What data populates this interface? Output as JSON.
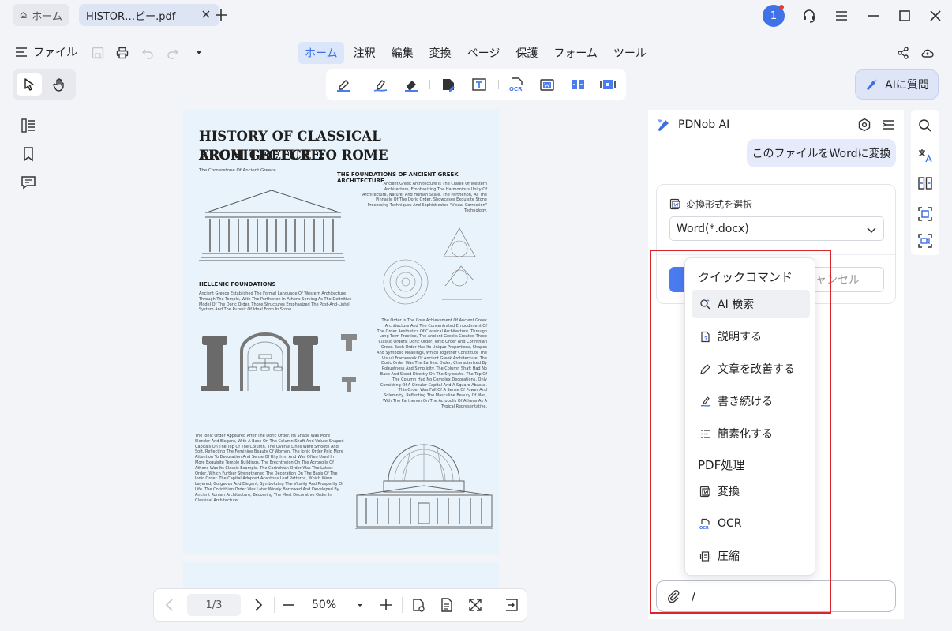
{
  "titlebar": {
    "home_tab": "ホーム",
    "file_tab": "HISTOR…ピー.pdf",
    "notification_count": "1"
  },
  "menubar": {
    "file_menu": "ファイル",
    "tabs": [
      "ホーム",
      "注釈",
      "編集",
      "変換",
      "ページ",
      "保護",
      "フォーム",
      "ツール"
    ],
    "active_tab": "ホーム"
  },
  "toolbar": {
    "ai_button": "AIに質問"
  },
  "document": {
    "title_line1": "HISTORY OF CLASSICAL  ARCHITECTURE:",
    "title_line2": "FROM GREECE TO ROME",
    "subtitle": "The Cornerstone Of Ancient Greece",
    "foundations_heading": "THE FOUNDATIONS OF ANCIENT GREEK ARCHITECTURE",
    "foundations_text": "Ancient Greek Architecture Is The Cradle Of Western Architecture, Emphasizing The Harmonious Unity Of Architecture, Nature, And Human Scale. The Parthenon, As The Pinnacle Of The Doric Order, Showcases Exquisite Stone Processing Techniques And Sophisticated \"Visual Correction\" Technology.",
    "hellenic_heading": "HELLENIC FOUNDATIONS",
    "hellenic_text": "Ancient Greece Established The Formal Language Of Western Architecture Through The Temple, With The Parthenon In Athens Serving As The Definitive Model Of The Doric Order. Those Structures Emphasized The Post-And-Lintel System And The Pursuit Of Ideal Form In Stone.",
    "order_text": "The Order Is The Core Achievement Of Ancient Greek Architecture And The Concentrated Embodiment Of The Order Aesthetics Of Classical Architecture. Through Long-Term Practice, The Ancient Greeks Created Three Classic Orders: Doric Order, Ionic Order And Corinthian Order. Each Order Has Its Unique Proportions, Shapes And Symbolic Meanings, Which Together Constitute The Visual Framework Of Ancient Greek Architecture. The Doric Order Was The Earliest Order, Characterized By Robustness And Simplicity. The Column Shaft Had No Base And Stood Directly On The Stylobate. The Top Of The Column Had No Complex Decorations, Only Consisting Of A Circular Capital And A Square Abacus. This Order Was Full Of A Sense Of Power And Solemnity, Reflecting The Masculine Beauty Of Man, With The Parthenon On The Acropolis Of Athens As A Typical Representative.",
    "ionic_text": "The Ionic Order Appeared After The Doric Order. Its Shape Was More Slender And Elegant, With A Base On The Column Shaft And Volute-Shaped Capitals On The Top Of The Column. The Overall Lines Were Smooth And Soft, Reflecting The Feminine Beauty Of Women. The Ionic Order Paid More Attention To Decoration And Sense Of Rhythm, And Was Often Used In More Exquisite Temple Buildings. The Erechtheion On The Acropolis Of Athens Was Its Classic Example. The Corinthian Order Was The Latest Order, Which Further Strengthened The Decoration On The Basis Of The Ionic Order. The Capital Adopted Acanthus Leaf Patterns, Which Were Layered, Gorgeous And Elegant, Symbolizing The Vitality And Prosperity Of Life. The Corinthian Order Was Later Widely Borrowed And Developed By Ancient Roman Architecture, Becoming The Most Decorative Order In Classical Architecture."
  },
  "bottom_nav": {
    "page_indicator": "1/3",
    "zoom": "50%"
  },
  "ai_panel": {
    "brand": "PDNob AI",
    "user_message": "このファイルをWordに変換",
    "convert_label": "変換形式を選択",
    "format_value": "Word(*.docx)",
    "cancel": "キャンセル",
    "input_value": "/"
  },
  "quick_popup": {
    "heading1": "クイックコマンド",
    "commands": [
      "AI 検索",
      "説明する",
      "文章を改善する",
      "書き続ける",
      "簡素化する"
    ],
    "heading2": "PDF処理",
    "pdf_commands": [
      "変換",
      "OCR",
      "圧縮"
    ]
  },
  "colors": {
    "accent": "#3d6fe3",
    "highlight": "#d9262c",
    "avatar": "#3f72e6"
  }
}
